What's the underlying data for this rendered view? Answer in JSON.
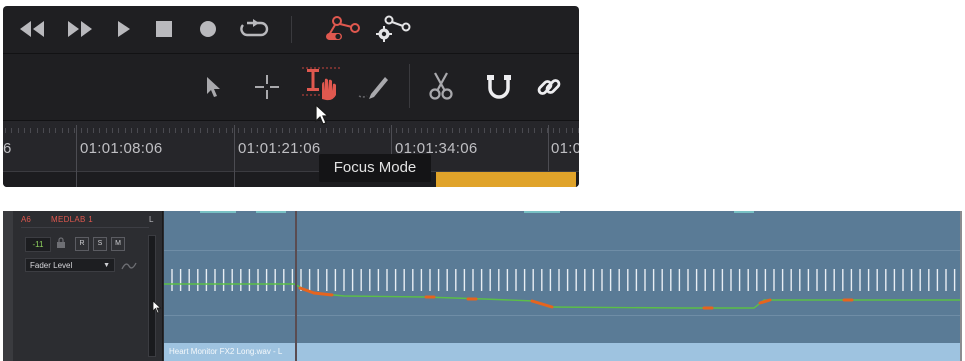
{
  "timeline": {
    "timecodes": [
      "6",
      "01:01:08:06",
      "01:01:21:06",
      "01:01:34:06",
      "01:0"
    ],
    "tooltip": "Focus Mode"
  },
  "transport": {
    "icons": [
      "rewind-icon",
      "fast-forward-icon",
      "play-icon",
      "stop-icon",
      "record-icon",
      "loop-icon",
      "automation-icon",
      "automation-settings-icon"
    ]
  },
  "tools": {
    "icons": [
      "pointer-icon",
      "range-selection-icon",
      "focus-mode-icon",
      "pencil-icon",
      "razor-icon",
      "snapping-icon",
      "linked-selection-icon"
    ]
  },
  "track": {
    "index": "A6",
    "name": "MEDLAB 1",
    "side": "L",
    "level": "-11",
    "buttons": [
      "R",
      "S",
      "M"
    ],
    "automation_mode": "Fader Level",
    "clip_name": "Heart Monitor FX2 Long.wav - L"
  },
  "colors": {
    "accent_red": "#e0584f",
    "clip_orange": "#e0a32a",
    "track_blue": "#5a7b96",
    "clip_label_blue": "#9ec3e0",
    "automation_green": "#5bbf47",
    "keyframe_orange": "#e6641e"
  }
}
